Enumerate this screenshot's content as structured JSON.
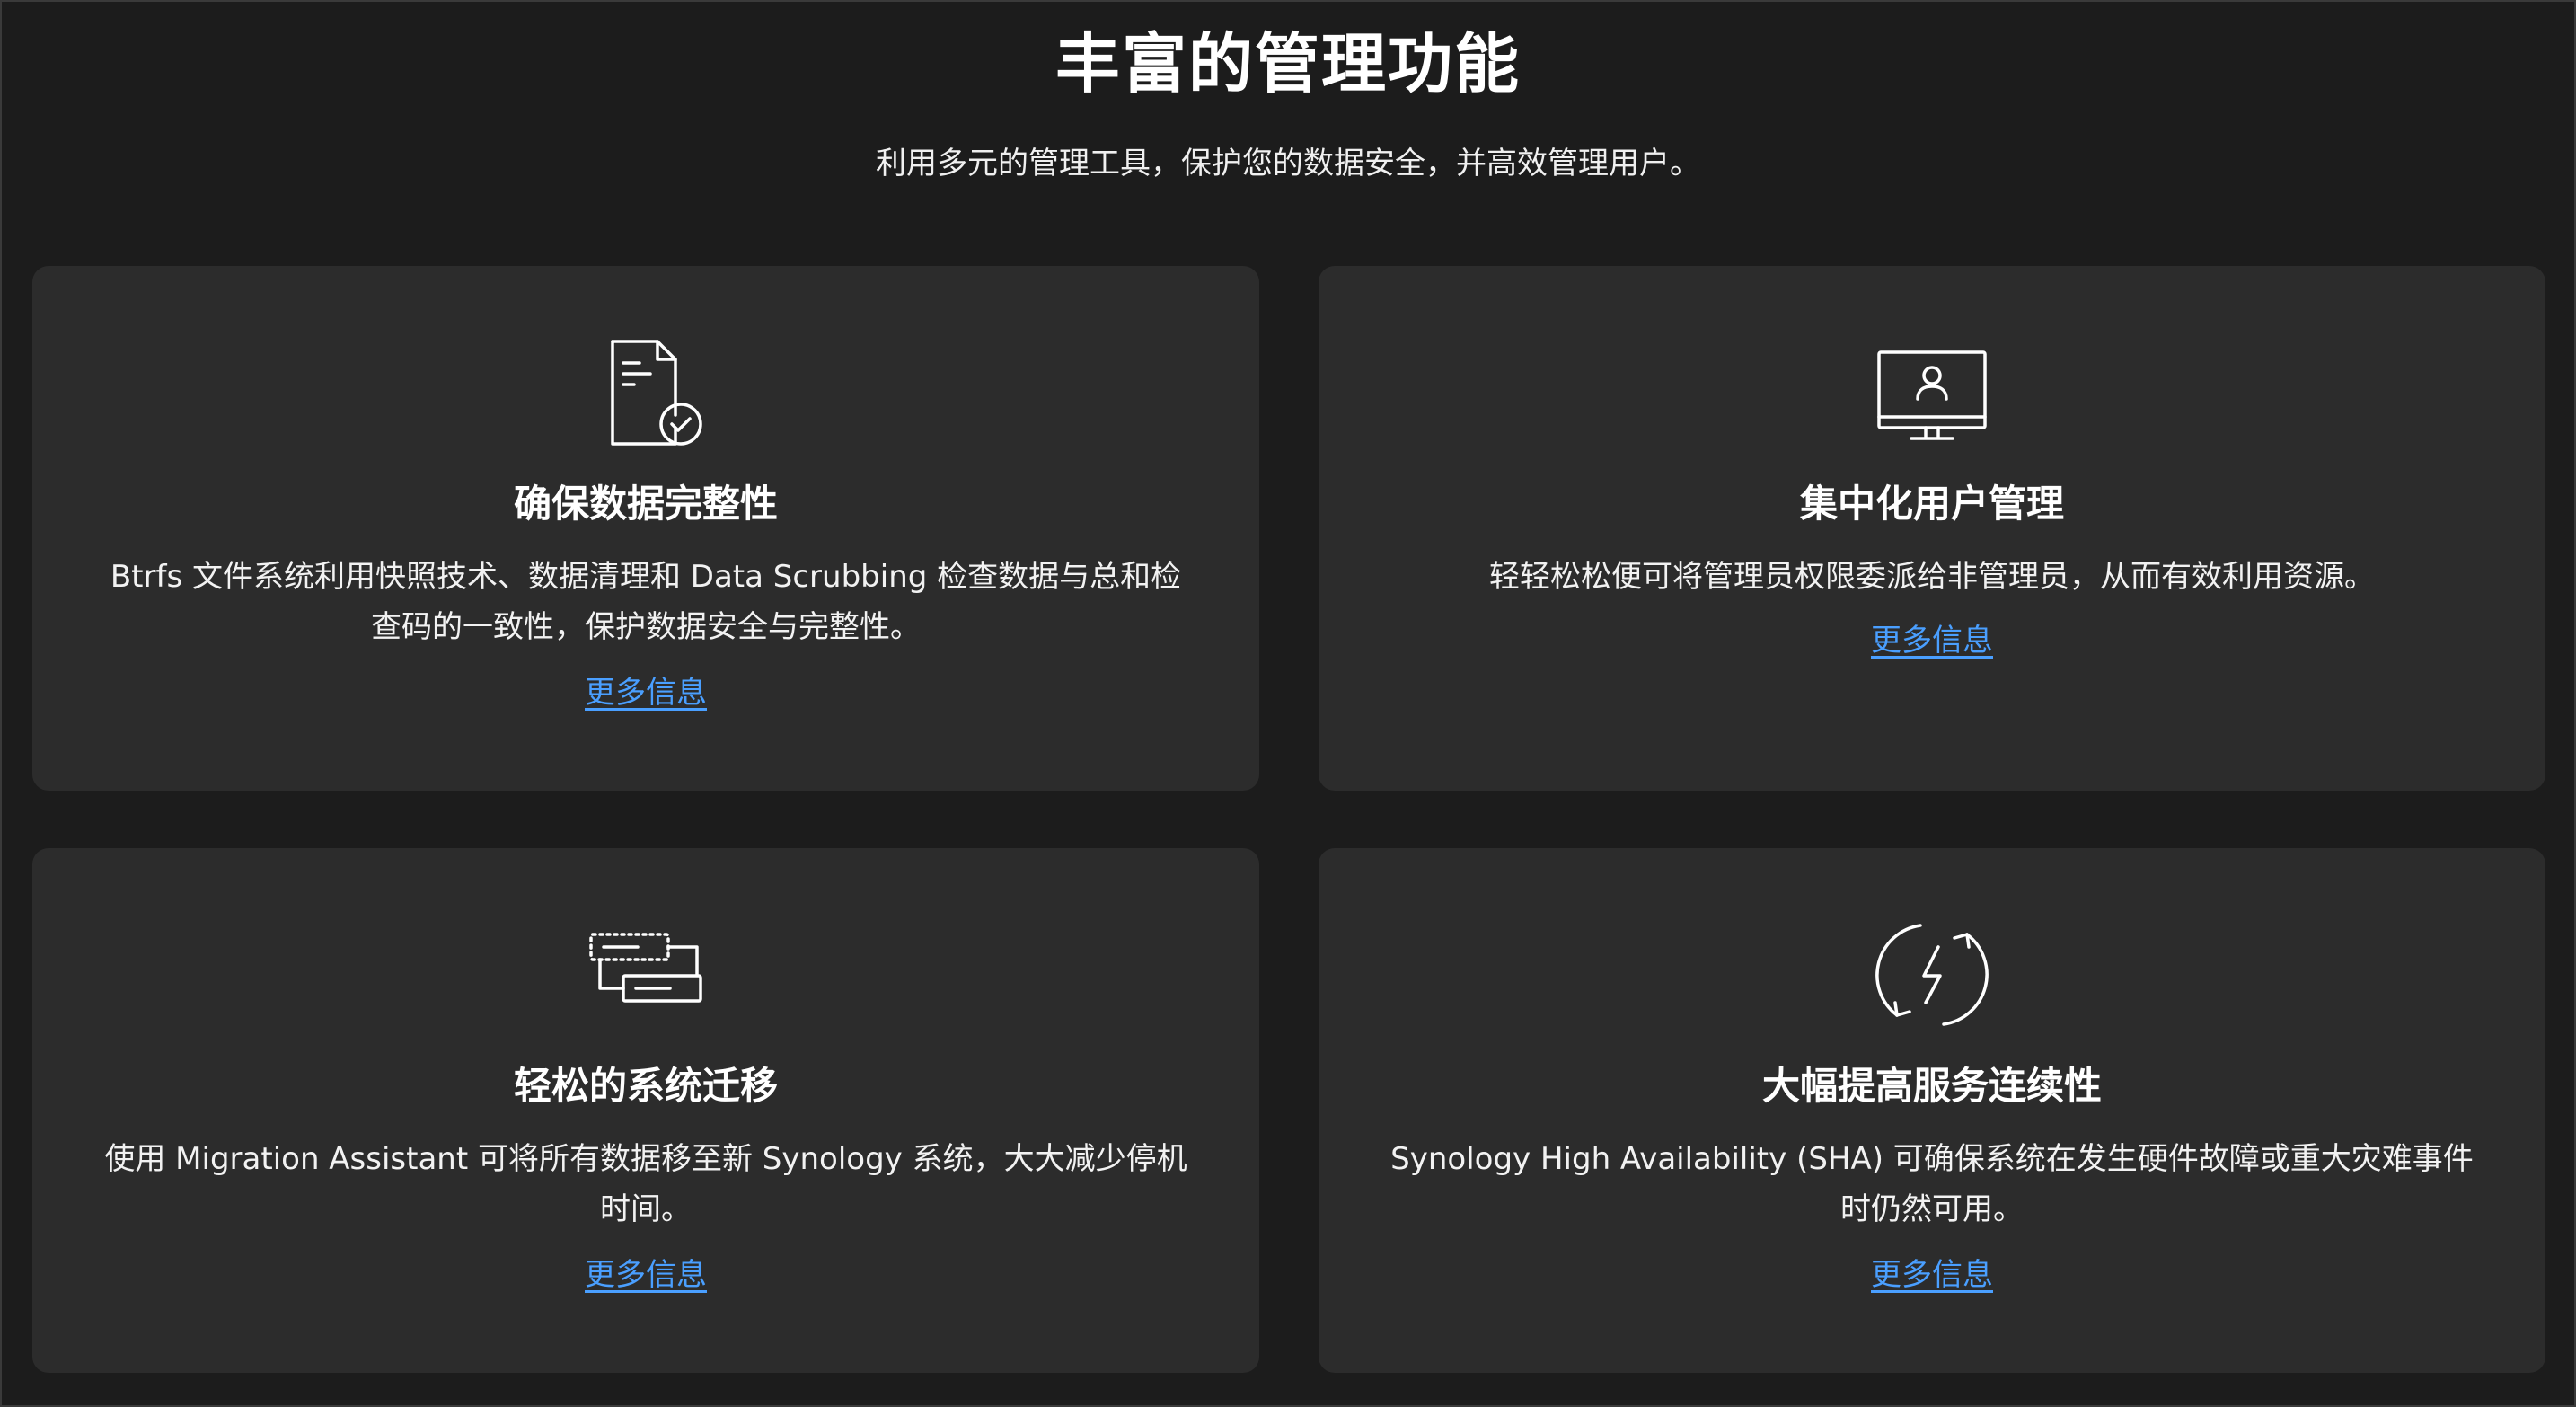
{
  "header": {
    "title": "丰富的管理功能",
    "subtitle": "利用多元的管理工具，保护您的数据安全，并高效管理用户。"
  },
  "cards": [
    {
      "icon": "document-check-icon",
      "title": "确保数据完整性",
      "description": "Btrfs 文件系统利用快照技术、数据清理和 Data Scrubbing 检查数据与总和检查码的一致性，保护数据安全与完整性。",
      "link": "更多信息"
    },
    {
      "icon": "monitor-user-icon",
      "title": "集中化用户管理",
      "description": "轻轻松松便可将管理员权限委派给非管理员，从而有效利用资源。",
      "link": "更多信息"
    },
    {
      "icon": "migration-icon",
      "title": "轻松的系统迁移",
      "description": "使用 Migration Assistant 可将所有数据移至新 Synology 系统，大大减少停机时间。",
      "link": "更多信息"
    },
    {
      "icon": "high-availability-icon",
      "title": "大幅提高服务连续性",
      "description": "Synology High Availability (SHA) 可确保系统在发生硬件故障或重大灾难事件时仍然可用。",
      "link": "更多信息"
    }
  ],
  "colors": {
    "background": "#1c1c1c",
    "card": "#2c2c2c",
    "link": "#4a9fff"
  }
}
